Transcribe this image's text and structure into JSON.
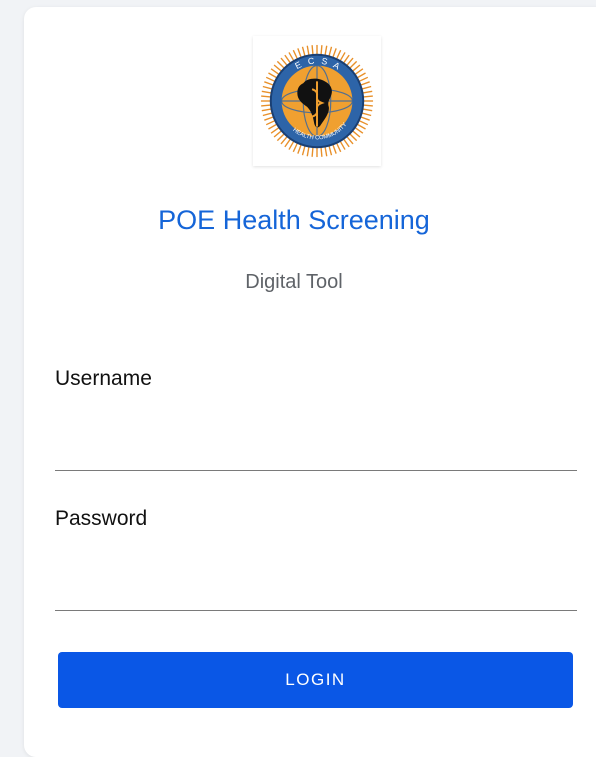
{
  "logo": {
    "icon": "ecsa-health-community-logo",
    "text_top": "E C S A",
    "text_bottom": "HEALTH COMMUNITY"
  },
  "header": {
    "title": "POE Health Screening",
    "subtitle": "Digital Tool"
  },
  "form": {
    "username": {
      "label": "Username",
      "value": ""
    },
    "password": {
      "label": "Password",
      "value": ""
    },
    "login_label": "LOGIN"
  },
  "colors": {
    "accent": "#0a57e6",
    "title": "#1565d8",
    "background": "#f1f3f6"
  }
}
